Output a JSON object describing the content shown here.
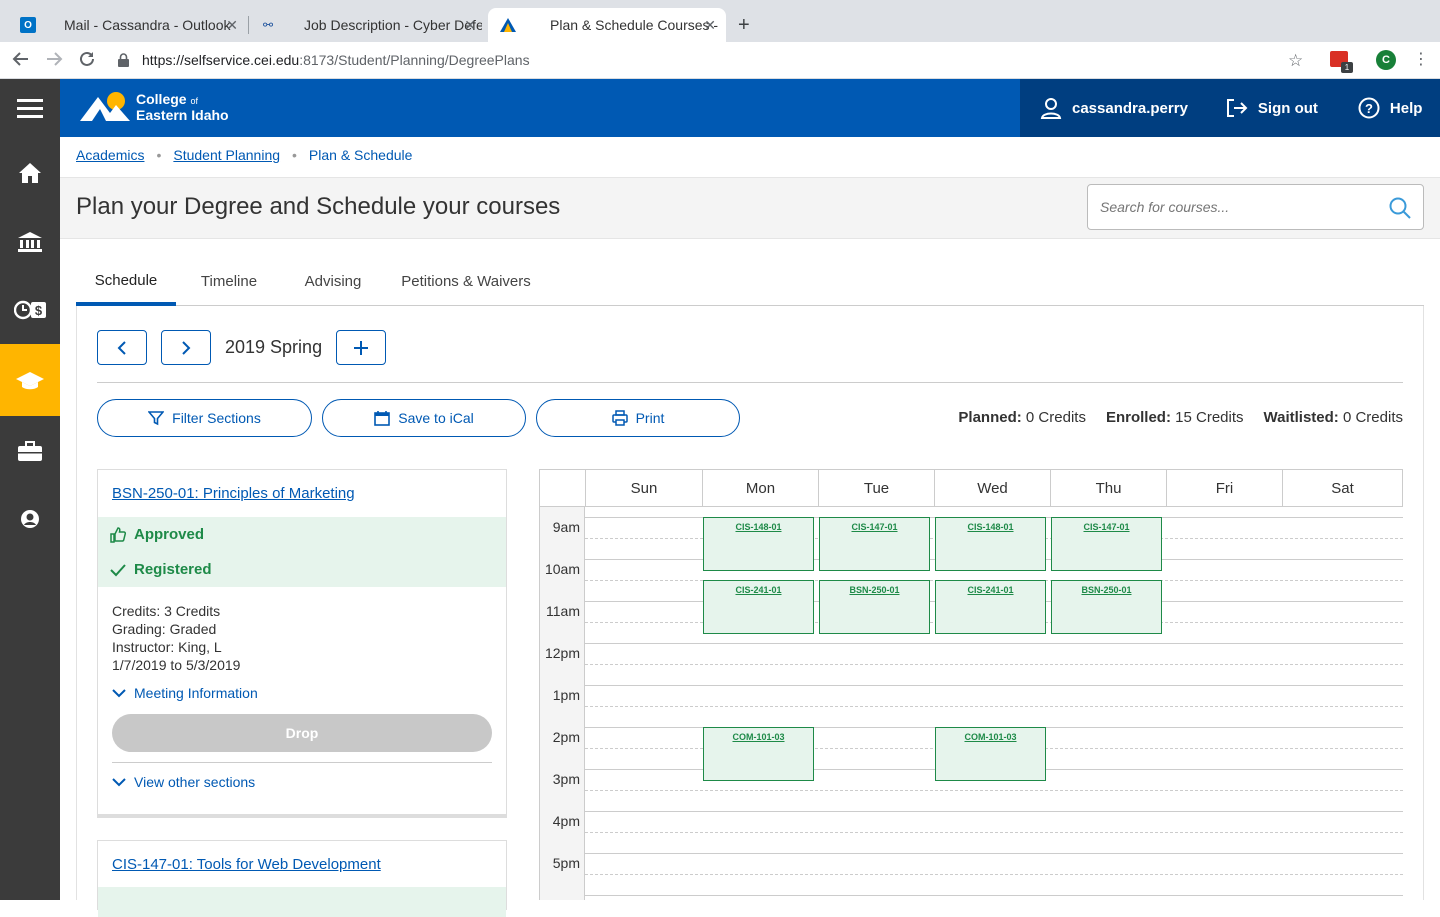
{
  "browser": {
    "tabs": [
      {
        "label": "Mail - Cassandra - Outlook",
        "active": false
      },
      {
        "label": "Job Description - Cyber Defen",
        "active": false
      },
      {
        "label": "Plan & Schedule Courses - Ellu",
        "active": true
      }
    ],
    "url_host": "https://selfservice.cei.edu",
    "url_path": ":8173/Student/Planning/DegreePlans",
    "ext_badge": "1",
    "profile_initial": "C"
  },
  "header": {
    "logo_line1": "College",
    "logo_of": "of",
    "logo_line2": "Eastern Idaho",
    "username": "cassandra.perry",
    "signout": "Sign out",
    "help": "Help"
  },
  "breadcrumb": [
    "Academics",
    "Student Planning",
    "Plan & Schedule"
  ],
  "page": {
    "title": "Plan your Degree and Schedule your courses",
    "search_placeholder": "Search for courses..."
  },
  "tabs": [
    "Schedule",
    "Timeline",
    "Advising",
    "Petitions & Waivers"
  ],
  "term": "2019 Spring",
  "actions": {
    "filter": "Filter Sections",
    "ical": "Save to iCal",
    "print": "Print"
  },
  "credits": {
    "planned_label": "Planned:",
    "planned_value": "0 Credits",
    "enrolled_label": "Enrolled:",
    "enrolled_value": "15 Credits",
    "waitlisted_label": "Waitlisted:",
    "waitlisted_value": "0 Credits"
  },
  "course1": {
    "title": "BSN-250-01: Principles of Marketing",
    "status1": "Approved",
    "status2": "Registered",
    "credits": "Credits: 3 Credits",
    "grading": "Grading: Graded",
    "instructor": "Instructor: King, L",
    "dates": "1/7/2019 to 5/3/2019",
    "meeting": "Meeting Information",
    "drop": "Drop",
    "other": "View other sections"
  },
  "course2": {
    "title": "CIS-147-01: Tools for Web Development"
  },
  "calendar": {
    "days": [
      "Sun",
      "Mon",
      "Tue",
      "Wed",
      "Thu",
      "Fri",
      "Sat"
    ],
    "times": [
      "9am",
      "10am",
      "11am",
      "12pm",
      "1pm",
      "2pm",
      "3pm",
      "4pm",
      "5pm"
    ],
    "events": [
      {
        "label": "CIS-148-01",
        "day": "Mon",
        "start": "9am"
      },
      {
        "label": "CIS-147-01",
        "day": "Tue",
        "start": "9am"
      },
      {
        "label": "CIS-148-01",
        "day": "Wed",
        "start": "9am"
      },
      {
        "label": "CIS-147-01",
        "day": "Thu",
        "start": "9am"
      },
      {
        "label": "CIS-241-01",
        "day": "Mon",
        "start": "10:30am"
      },
      {
        "label": "BSN-250-01",
        "day": "Tue",
        "start": "10:30am"
      },
      {
        "label": "CIS-241-01",
        "day": "Wed",
        "start": "10:30am"
      },
      {
        "label": "BSN-250-01",
        "day": "Thu",
        "start": "10:30am"
      },
      {
        "label": "COM-101-03",
        "day": "Mon",
        "start": "2pm"
      },
      {
        "label": "COM-101-03",
        "day": "Wed",
        "start": "2pm"
      }
    ]
  },
  "colors": {
    "brand_blue": "#0059b3",
    "accent_gold": "#ffb500",
    "success_green": "#1e8a48"
  }
}
